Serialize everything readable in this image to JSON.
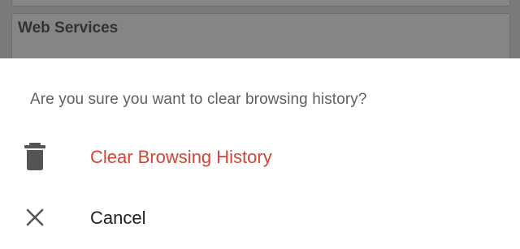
{
  "background": {
    "section_title": "Web Services"
  },
  "dialog": {
    "prompt": "Are you sure you want to clear browsing history?",
    "options": [
      {
        "label": "Clear Browsing History",
        "icon": "trash-icon",
        "color": "#d24436"
      },
      {
        "label": "Cancel",
        "icon": "close-icon",
        "color": "#212121"
      }
    ]
  },
  "colors": {
    "scrim": "#7a7a7a",
    "sheet": "#ffffff",
    "prompt_text": "#5f5f5f",
    "icon": "#555555",
    "destructive": "#d24436"
  }
}
